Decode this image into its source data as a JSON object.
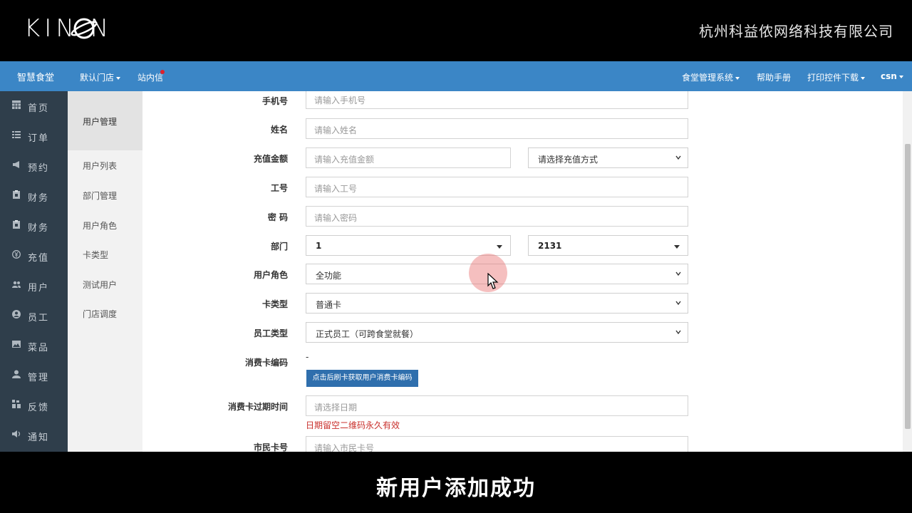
{
  "banner": {
    "logo": "KIN  N",
    "company": "杭州科益侬网络科技有限公司"
  },
  "navbar": {
    "brand": "智慧食堂",
    "left_items": [
      "默认门店",
      "站内信"
    ],
    "right_items": [
      "食堂管理系统",
      "帮助手册",
      "打印控件下载",
      "csn"
    ]
  },
  "sidebar": {
    "items": [
      {
        "label": "首页",
        "icon": "table-icon"
      },
      {
        "label": "订单",
        "icon": "list-icon"
      },
      {
        "label": "预约",
        "icon": "bullhorn-icon"
      },
      {
        "label": "财务",
        "icon": "clipboard-icon"
      },
      {
        "label": "财务",
        "icon": "clipboard-icon"
      },
      {
        "label": "充值",
        "icon": "yen-icon"
      },
      {
        "label": "用户",
        "icon": "users-icon"
      },
      {
        "label": "员工",
        "icon": "user-circle-icon"
      },
      {
        "label": "菜品",
        "icon": "image-icon"
      },
      {
        "label": "管理",
        "icon": "user-icon"
      },
      {
        "label": "反馈",
        "icon": "feedback-icon"
      },
      {
        "label": "通知",
        "icon": "volume-icon"
      }
    ]
  },
  "subnav": {
    "header": "用户管理",
    "items": [
      "用户列表",
      "部门管理",
      "用户角色",
      "卡类型",
      "测试用户",
      "门店调度"
    ]
  },
  "form": {
    "phone": {
      "label": "手机号",
      "placeholder": "请输入手机号"
    },
    "name": {
      "label": "姓名",
      "placeholder": "请输入姓名"
    },
    "recharge": {
      "label": "充值金额",
      "placeholder": "请输入充值金额",
      "method": "请选择充值方式"
    },
    "job_no": {
      "label": "工号",
      "placeholder": "请输入工号"
    },
    "password": {
      "label": "密 码",
      "placeholder": "请输入密码"
    },
    "department": {
      "label": "部门",
      "value1": "1",
      "value2": "2131"
    },
    "role": {
      "label": "用户角色",
      "value": "全功能"
    },
    "card_type": {
      "label": "卡类型",
      "value": "普通卡"
    },
    "staff_type": {
      "label": "员工类型",
      "value": "正式员工（可跨食堂就餐）"
    },
    "card_code": {
      "label": "消费卡编码",
      "value": "-",
      "button": "点击后刷卡获取用户消费卡编码"
    },
    "expire": {
      "label": "消费卡过期时间",
      "placeholder": "请选择日期",
      "hint": "日期留空二维码永久有效"
    },
    "citizen": {
      "label": "市民卡号",
      "placeholder": "请输入市民卡号"
    }
  },
  "caption": "新用户添加成功"
}
